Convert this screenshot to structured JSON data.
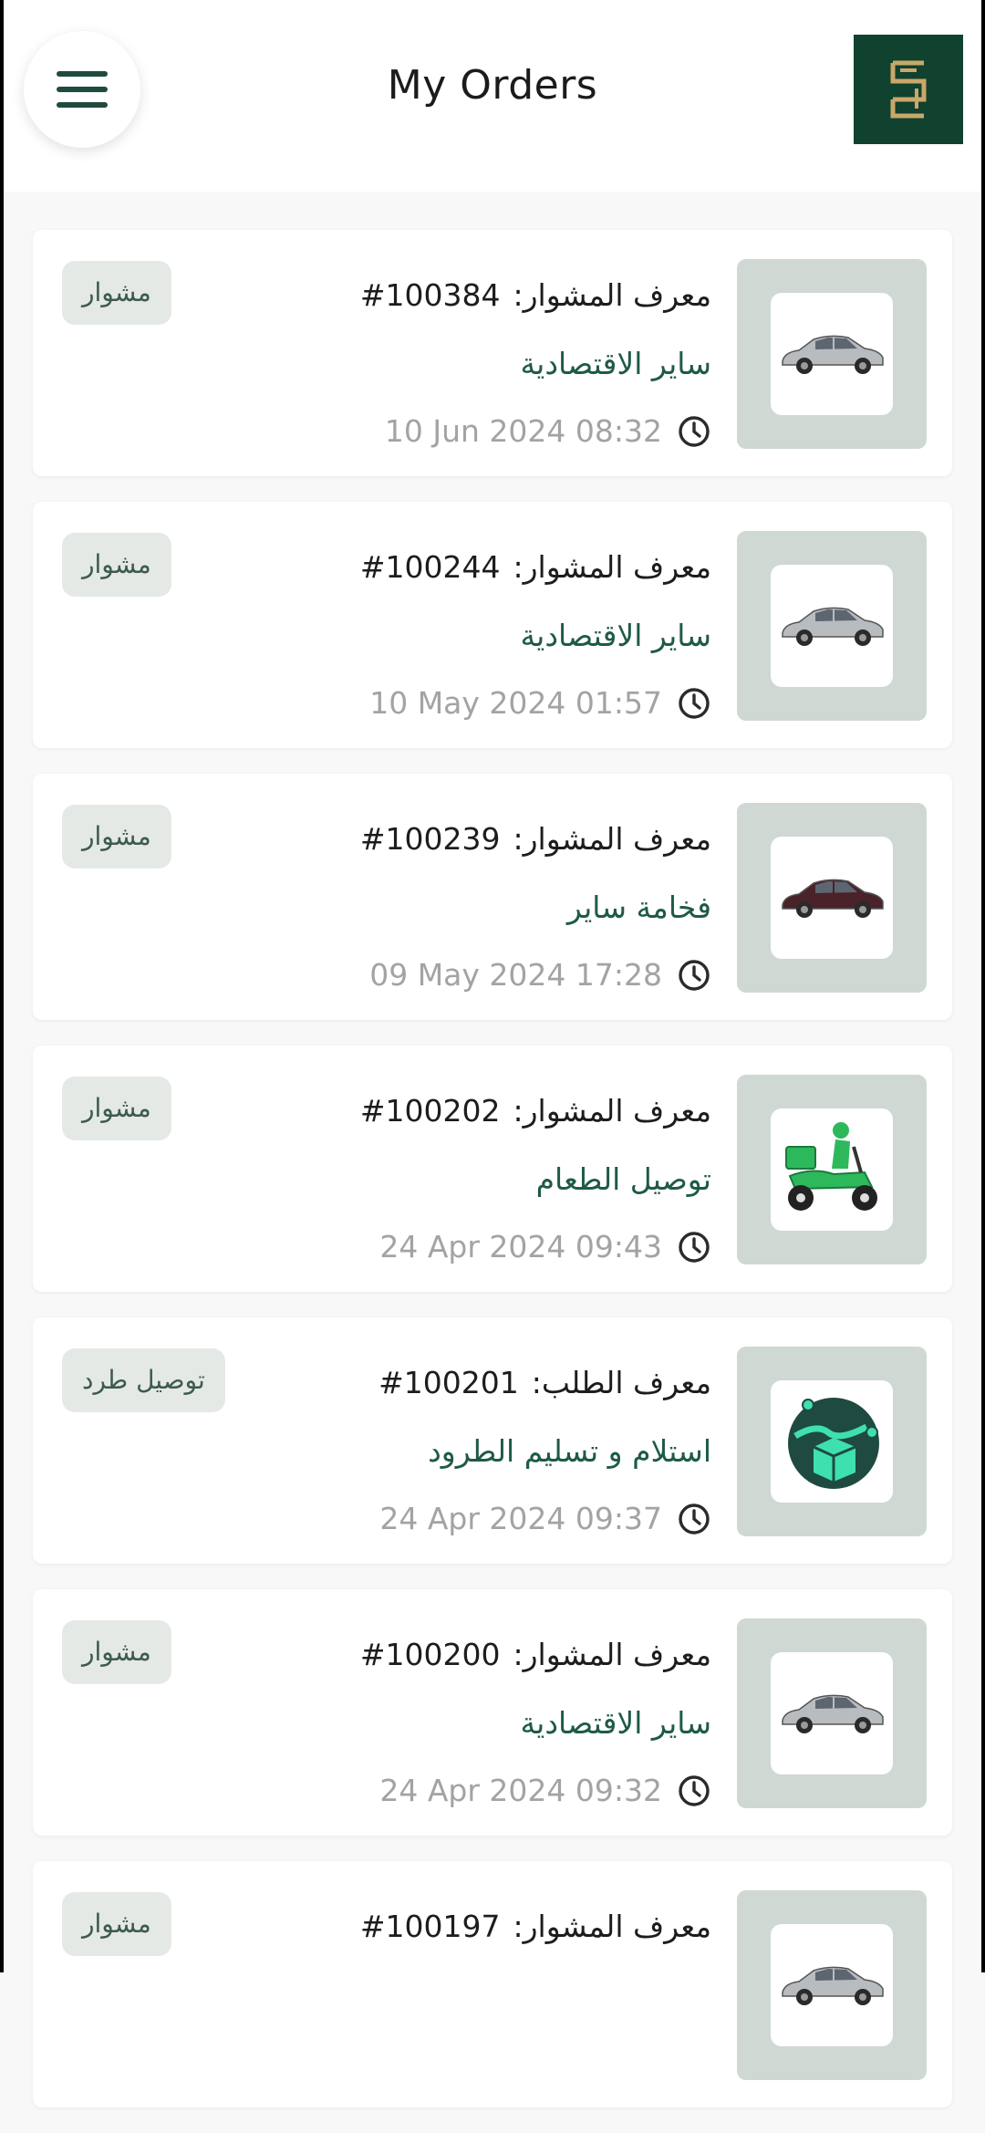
{
  "header": {
    "title": "My Orders"
  },
  "orders": [
    {
      "id_label": "معرف المشوار:",
      "id_value": "#100384",
      "service": "ساير الاقتصادية",
      "date": "10 Jun 2024  08:32",
      "badge": "مشوار",
      "thumbnail_icon": "silver-sedan-icon",
      "car_color": "#b9bcbf"
    },
    {
      "id_label": "معرف المشوار:",
      "id_value": "#100244",
      "service": "ساير الاقتصادية",
      "date": "10 May 2024  01:57",
      "badge": "مشوار",
      "thumbnail_icon": "silver-sedan-icon",
      "car_color": "#b9bcbf"
    },
    {
      "id_label": "معرف المشوار:",
      "id_value": "#100239",
      "service": "فخامة ساير",
      "date": "09 May 2024  17:28",
      "badge": "مشوار",
      "thumbnail_icon": "luxury-sedan-icon",
      "car_color": "#4a2229"
    },
    {
      "id_label": "معرف المشوار:",
      "id_value": "#100202",
      "service": "توصيل الطعام",
      "date": "24 Apr 2024  09:43",
      "badge": "مشوار",
      "thumbnail_icon": "delivery-scooter-icon",
      "car_color": "#2eb85c"
    },
    {
      "id_label": "معرف الطلب:",
      "id_value": "#100201",
      "service": "استلام و تسليم الطرود",
      "date": "24 Apr 2024  09:37",
      "badge": "توصيل طرد",
      "thumbnail_icon": "parcel-delivery-icon",
      "car_color": "#1f5a48"
    },
    {
      "id_label": "معرف المشوار:",
      "id_value": "#100200",
      "service": "ساير الاقتصادية",
      "date": "24 Apr 2024  09:32",
      "badge": "مشوار",
      "thumbnail_icon": "silver-sedan-icon",
      "car_color": "#b9bcbf"
    },
    {
      "id_label": "معرف المشوار:",
      "id_value": "#100197",
      "service": "",
      "date": "",
      "badge": "مشوار",
      "thumbnail_icon": "silver-sedan-icon",
      "car_color": "#b9bcbf"
    }
  ],
  "colors": {
    "brand": "#11412f",
    "accent_text": "#1f5a48",
    "thumb_bg": "#cfd8d3",
    "badge_bg": "#e4e9e6"
  }
}
